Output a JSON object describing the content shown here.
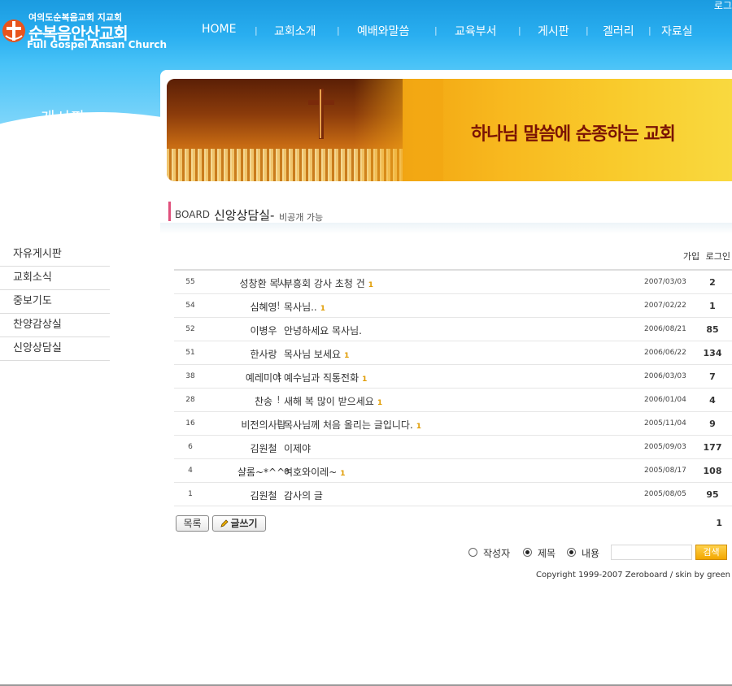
{
  "header": {
    "logo_subtitle": "여의도순복음교회 지교회",
    "logo_name": "순복음안산교회",
    "logo_english": "Full Gospel Ansan Church",
    "login_link": "로그",
    "nav": [
      "HOME",
      "교회소개",
      "예배와말씀",
      "교육부서",
      "게시판",
      "겔러리",
      "자료실"
    ],
    "nav_separator": "|"
  },
  "sidebar": {
    "section_title": "게시판",
    "section_subtitle": "BOARD",
    "items": [
      "자유게시판",
      "교회소식",
      "중보기도",
      "찬양감상실",
      "신앙상담실"
    ]
  },
  "banner": {
    "slogan": "하나님 말씀에 순종하는 교회"
  },
  "board": {
    "heading_prefix": "BOARD",
    "heading_title": "신앙상담실-",
    "heading_sub": "비공개 가능",
    "top_links": [
      "가입",
      "로그인"
    ],
    "rows": [
      {
        "num": "55",
        "author": "성창환 목사",
        "secret": "!",
        "title": "부흥회 강사 초청 건",
        "comments": "1",
        "date": "2007/03/03",
        "hits": "2"
      },
      {
        "num": "54",
        "author": "심혜영",
        "secret": "!",
        "title": "목사님..",
        "comments": "1",
        "date": "2007/02/22",
        "hits": "1"
      },
      {
        "num": "52",
        "author": "이병우",
        "secret": "",
        "title": "안녕하세요 목사님.",
        "comments": "",
        "date": "2006/08/21",
        "hits": "85"
      },
      {
        "num": "51",
        "author": "한사랑",
        "secret": "",
        "title": "목사님 보세요",
        "comments": "1",
        "date": "2006/06/22",
        "hits": "134"
      },
      {
        "num": "38",
        "author": "예레미야",
        "secret": "!",
        "title": "예수님과 직통전화",
        "comments": "1",
        "date": "2006/03/03",
        "hits": "7"
      },
      {
        "num": "28",
        "author": "찬송",
        "secret": "!",
        "title": "새해 복 많이 받으세요",
        "comments": "1",
        "date": "2006/01/04",
        "hits": "4"
      },
      {
        "num": "16",
        "author": "비전의사람",
        "secret": "!",
        "title": "목사님께 처음 올리는 글입니다.",
        "comments": "1",
        "date": "2005/11/04",
        "hits": "9"
      },
      {
        "num": "6",
        "author": "김원철",
        "secret": "",
        "title": "이제야",
        "comments": "",
        "date": "2005/09/03",
        "hits": "177"
      },
      {
        "num": "4",
        "author": "샬롬~*^^*",
        "secret": "",
        "title": "여호와이레~",
        "comments": "1",
        "date": "2005/08/17",
        "hits": "108"
      },
      {
        "num": "1",
        "author": "김원철",
        "secret": "",
        "title": "감사의 글",
        "comments": "",
        "date": "2005/08/05",
        "hits": "95"
      }
    ],
    "list_button": "목록",
    "write_button": "글쓰기",
    "page": "1"
  },
  "search": {
    "options": [
      {
        "label": "작성자",
        "checked": false
      },
      {
        "label": "제목",
        "checked": true
      },
      {
        "label": "내용",
        "checked": true
      }
    ],
    "button": "검색",
    "value": ""
  },
  "footer": {
    "copyright": "Copyright 1999-2007 Zeroboard / skin by green"
  },
  "colors": {
    "header_blue": "#1b9be0",
    "accent_pink": "#e0507c",
    "comment_orange": "#e09b00",
    "search_button": "#f3a700"
  }
}
